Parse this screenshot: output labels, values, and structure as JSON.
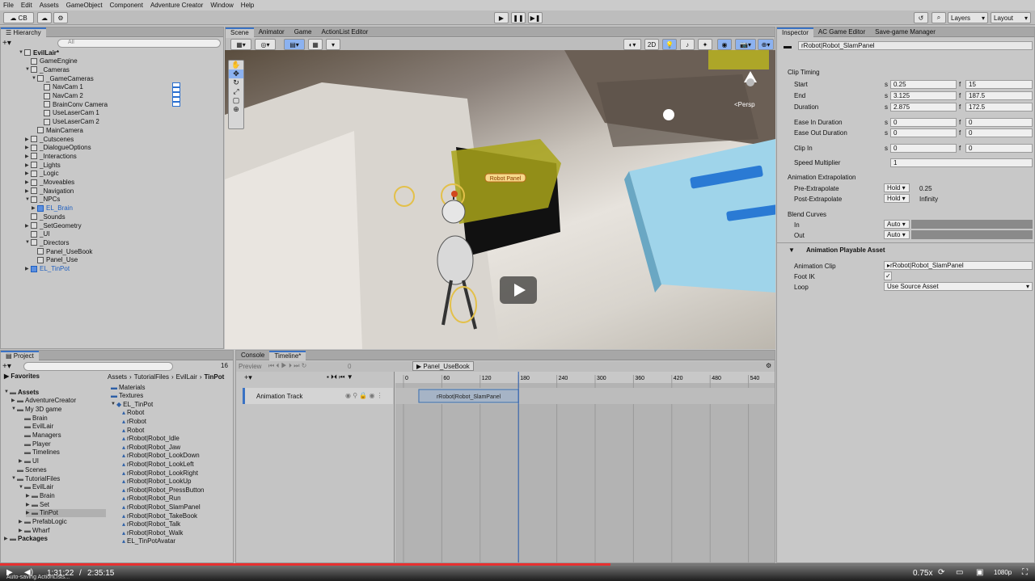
{
  "menu": [
    "File",
    "Edit",
    "Assets",
    "GameObject",
    "Component",
    "Adventure Creator",
    "Window",
    "Help"
  ],
  "toolbar": {
    "account": "CB",
    "layers": "Layers",
    "layout": "Layout"
  },
  "hierarchy": {
    "tab": "Hierarchy",
    "search_placeholder": "All",
    "items": [
      {
        "label": "EvilLair*",
        "indent": 0,
        "arrow": "▼"
      },
      {
        "label": "GameEngine",
        "indent": 1,
        "arrow": ""
      },
      {
        "label": "_Cameras",
        "indent": 1,
        "arrow": "▼"
      },
      {
        "label": "_GameCameras",
        "indent": 2,
        "arrow": "▼"
      },
      {
        "label": "NavCam 1",
        "indent": 3,
        "arrow": ""
      },
      {
        "label": "NavCam 2",
        "indent": 3,
        "arrow": ""
      },
      {
        "label": "BrainConv Camera",
        "indent": 3,
        "arrow": ""
      },
      {
        "label": "UseLaserCam 1",
        "indent": 3,
        "arrow": ""
      },
      {
        "label": "UseLaserCam 2",
        "indent": 3,
        "arrow": ""
      },
      {
        "label": "MainCamera",
        "indent": 2,
        "arrow": ""
      },
      {
        "label": "_Cutscenes",
        "indent": 1,
        "arrow": "▶"
      },
      {
        "label": "_DialogueOptions",
        "indent": 1,
        "arrow": "▶"
      },
      {
        "label": "_Interactions",
        "indent": 1,
        "arrow": "▶"
      },
      {
        "label": "_Lights",
        "indent": 1,
        "arrow": "▶"
      },
      {
        "label": "_Logic",
        "indent": 1,
        "arrow": "▶"
      },
      {
        "label": "_Moveables",
        "indent": 1,
        "arrow": "▶"
      },
      {
        "label": "_Navigation",
        "indent": 1,
        "arrow": "▶"
      },
      {
        "label": "_NPCs",
        "indent": 1,
        "arrow": "▼"
      },
      {
        "label": "EL_Brain",
        "indent": 2,
        "arrow": "▶",
        "blue": true
      },
      {
        "label": "_Sounds",
        "indent": 1,
        "arrow": ""
      },
      {
        "label": "_SetGeometry",
        "indent": 1,
        "arrow": "▶"
      },
      {
        "label": "_UI",
        "indent": 1,
        "arrow": ""
      },
      {
        "label": "_Directors",
        "indent": 1,
        "arrow": "▼"
      },
      {
        "label": "Panel_UseBook",
        "indent": 2,
        "arrow": ""
      },
      {
        "label": "Panel_Use",
        "indent": 2,
        "arrow": ""
      },
      {
        "label": "EL_TinPot",
        "indent": 1,
        "arrow": "▶",
        "blue": true
      }
    ]
  },
  "scene_tabs": [
    "Scene",
    "Animator",
    "Game",
    "ActionList Editor"
  ],
  "scene": {
    "mode_2d": "2D",
    "persp": "<Persp",
    "sign": "Robot Panel"
  },
  "inspector": {
    "tabs": [
      "Inspector",
      "AC Game Editor",
      "Save-game Manager"
    ],
    "object_name": "rRobot|Robot_SlamPanel",
    "clip_timing": "Clip Timing",
    "rows": [
      {
        "label": "Start",
        "s": "0.25",
        "f": "15"
      },
      {
        "label": "End",
        "s": "3.125",
        "f": "187.5"
      },
      {
        "label": "Duration",
        "s": "2.875",
        "f": "172.5"
      },
      {
        "label": "Ease In Duration",
        "s": "0",
        "f": "0"
      },
      {
        "label": "Ease Out Duration",
        "s": "0",
        "f": "0"
      },
      {
        "label": "Clip In",
        "s": "0",
        "f": "0"
      }
    ],
    "speed_label": "Speed Multiplier",
    "speed_value": "1",
    "extrapolation": "Animation Extrapolation",
    "pre_label": "Pre-Extrapolate",
    "pre_mode": "Hold",
    "pre_value": "0.25",
    "post_label": "Post-Extrapolate",
    "post_mode": "Hold",
    "post_value": "Infinity",
    "blend": "Blend Curves",
    "in_label": "In",
    "in_value": "Auto",
    "out_label": "Out",
    "out_value": "Auto",
    "playable": "Animation Playable Asset",
    "clip_label": "Animation Clip",
    "clip_value": "rRobot|Robot_SlamPanel",
    "footik_label": "Foot IK",
    "footik_value": "✓",
    "loop_label": "Loop",
    "loop_value": "Use Source Asset"
  },
  "project": {
    "tab": "Project",
    "count": "16",
    "breadcrumb": [
      "Assets",
      "TutorialFiles",
      "EvilLair",
      "TinPot"
    ],
    "favorites": "Favorites",
    "tree": [
      {
        "label": "Assets",
        "indent": 0,
        "arrow": "▼",
        "bold": true
      },
      {
        "label": "AdventureCreator",
        "indent": 1,
        "arrow": "▶"
      },
      {
        "label": "My 3D game",
        "indent": 1,
        "arrow": "▼"
      },
      {
        "label": "Brain",
        "indent": 2,
        "arrow": ""
      },
      {
        "label": "EvilLair",
        "indent": 2,
        "arrow": ""
      },
      {
        "label": "Managers",
        "indent": 2,
        "arrow": ""
      },
      {
        "label": "Player",
        "indent": 2,
        "arrow": ""
      },
      {
        "label": "Timelines",
        "indent": 2,
        "arrow": ""
      },
      {
        "label": "UI",
        "indent": 2,
        "arrow": "▶"
      },
      {
        "label": "Scenes",
        "indent": 1,
        "arrow": ""
      },
      {
        "label": "TutorialFiles",
        "indent": 1,
        "arrow": "▼"
      },
      {
        "label": "EvilLair",
        "indent": 2,
        "arrow": "▼"
      },
      {
        "label": "Brain",
        "indent": 3,
        "arrow": "▶"
      },
      {
        "label": "Set",
        "indent": 3,
        "arrow": "▶"
      },
      {
        "label": "TinPot",
        "indent": 3,
        "arrow": "▶",
        "selected": true
      },
      {
        "label": "PrefabLogic",
        "indent": 2,
        "arrow": "▶"
      },
      {
        "label": "Wharf",
        "indent": 2,
        "arrow": "▶"
      },
      {
        "label": "Packages",
        "indent": 0,
        "arrow": "▶",
        "bold": true
      }
    ],
    "files": [
      "Materials",
      "Textures",
      "EL_TinPot",
      "Robot",
      "rRobot",
      "Robot",
      "rRobot|Robot_Idle",
      "rRobot|Robot_Jaw",
      "rRobot|Robot_LookDown",
      "rRobot|Robot_LookLeft",
      "rRobot|Robot_LookRight",
      "rRobot|Robot_LookUp",
      "rRobot|Robot_PressButton",
      "rRobot|Robot_Run",
      "rRobot|Robot_SlamPanel",
      "rRobot|Robot_TakeBook",
      "rRobot|Robot_Talk",
      "rRobot|Robot_Walk",
      "EL_TinPotAvatar"
    ]
  },
  "timeline": {
    "tabs": [
      "Console",
      "Timeline*"
    ],
    "preview": "Preview",
    "frame": "0",
    "asset": "Panel_UseBook",
    "ticks": [
      "0",
      "60",
      "120",
      "180",
      "240",
      "300",
      "360",
      "420",
      "480",
      "540"
    ],
    "track": "Animation Track",
    "clip": "rRobot|Robot_SlamPanel",
    "playhead": 180
  },
  "status": "Auto-saving ActionLists...",
  "video": {
    "current": "1:31:22",
    "total": "2:35:15",
    "speed": "0.75x",
    "quality": "1080p",
    "progress": 0.59
  }
}
